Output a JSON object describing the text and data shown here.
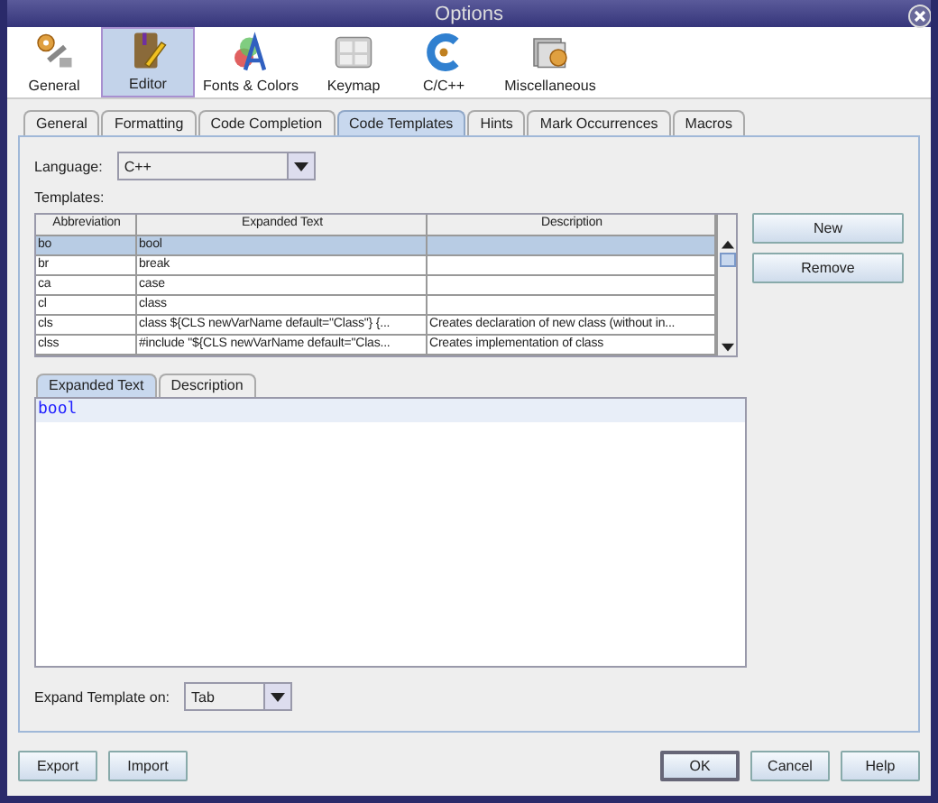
{
  "window": {
    "title": "Options"
  },
  "categories": [
    {
      "label": "General",
      "kind": "gears",
      "selected": false
    },
    {
      "label": "Editor",
      "kind": "pencil",
      "selected": true
    },
    {
      "label": "Fonts & Colors",
      "kind": "fonts",
      "selected": false
    },
    {
      "label": "Keymap",
      "kind": "keys",
      "selected": false
    },
    {
      "label": "C/C++",
      "kind": "cpp",
      "selected": false
    },
    {
      "label": "Miscellaneous",
      "kind": "misc",
      "selected": false
    }
  ],
  "tabs": [
    {
      "label": "General",
      "selected": false
    },
    {
      "label": "Formatting",
      "selected": false
    },
    {
      "label": "Code Completion",
      "selected": false
    },
    {
      "label": "Code Templates",
      "selected": true
    },
    {
      "label": "Hints",
      "selected": false
    },
    {
      "label": "Mark Occurrences",
      "selected": false
    },
    {
      "label": "Macros",
      "selected": false
    }
  ],
  "language": {
    "label": "Language:",
    "value": "C++"
  },
  "templates": {
    "label": "Templates:",
    "columns": [
      "Abbreviation",
      "Expanded Text",
      "Description"
    ],
    "rows": [
      {
        "cells": [
          "bo",
          "bool",
          ""
        ],
        "selected": true
      },
      {
        "cells": [
          "br",
          "break",
          ""
        ],
        "selected": false
      },
      {
        "cells": [
          "ca",
          "case",
          ""
        ],
        "selected": false
      },
      {
        "cells": [
          "cl",
          "class",
          ""
        ],
        "selected": false
      },
      {
        "cells": [
          "cls",
          "class ${CLS newVarName default=\"Class\"} {...",
          "Creates declaration of new class (without in..."
        ],
        "selected": false
      },
      {
        "cells": [
          "clss",
          "#include \"${CLS newVarName default=\"Clas...",
          "Creates implementation of class"
        ],
        "selected": false
      }
    ]
  },
  "side_buttons": [
    "New",
    "Remove"
  ],
  "detail_tabs": [
    {
      "label": "Expanded Text",
      "selected": true
    },
    {
      "label": "Description",
      "selected": false
    }
  ],
  "editor": {
    "lines": [
      "bool"
    ]
  },
  "expand_on": {
    "label": "Expand Template on:",
    "value": "Tab"
  },
  "footer_left": [
    "Export",
    "Import"
  ],
  "footer_right": [
    "OK",
    "Cancel",
    "Help"
  ]
}
